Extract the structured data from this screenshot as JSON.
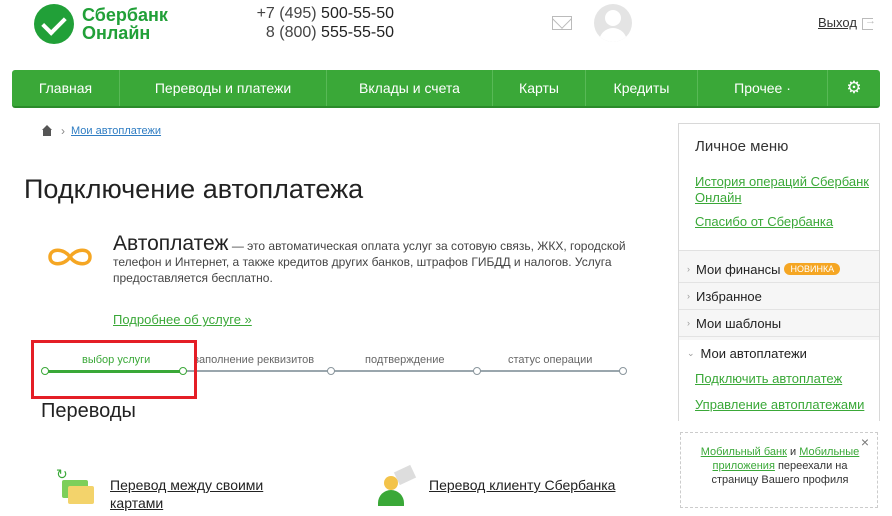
{
  "header": {
    "logo_line1": "Сбербанк",
    "logo_line2": "Онлайн",
    "phone1_prefix": "+7 (495) ",
    "phone1_num": "500-55-50",
    "phone2_prefix": "8 (800) ",
    "phone2_num": "555-55-50",
    "logout": "Выход"
  },
  "nav": {
    "items": [
      "Главная",
      "Переводы и платежи",
      "Вклады и счета",
      "Карты",
      "Кредиты",
      "Прочее ·"
    ],
    "settings_icon": "gear-icon"
  },
  "breadcrumb": {
    "current": "Мои автоплатежи"
  },
  "page": {
    "title": "Подключение автоплатежа"
  },
  "info": {
    "title": "Автоплатеж",
    "description": "— это автоматическая оплата услуг за сотовую связь, ЖКХ, городской телефон и Интернет, а также кредитов других банков, штрафов ГИБДД и налогов. Услуга предоставляется бесплатно.",
    "more_link": "Подробнее об услуге »"
  },
  "steps": [
    {
      "label": "выбор услуги",
      "active": true
    },
    {
      "label": "заполнение реквизитов",
      "active": false
    },
    {
      "label": "подтверждение",
      "active": false
    },
    {
      "label": "статус операции",
      "active": false
    }
  ],
  "section": {
    "title": "Переводы",
    "services": [
      {
        "label": "Перевод между своими картами"
      },
      {
        "label": "Перевод клиенту Сбербанка"
      }
    ]
  },
  "sidebar": {
    "title": "Личное меню",
    "links": [
      "История операций Сбербанк Онлайн",
      "Спасибо от Сбербанка"
    ],
    "items": [
      "Мои финансы",
      "Избранное",
      "Мои шаблоны"
    ],
    "badge": "НОВИНКА",
    "open_item": "Мои автоплатежи",
    "sub_links": [
      "Подключить автоплатеж",
      "Управление автоплатежами"
    ]
  },
  "notice": {
    "link1": "Мобильный банк",
    "and": " и ",
    "link2": "Мобильные приложения",
    "rest": " переехали на страницу Вашего профиля",
    "close": "×"
  },
  "colors": {
    "brand": "#3aa838",
    "highlight": "#e41e26"
  }
}
